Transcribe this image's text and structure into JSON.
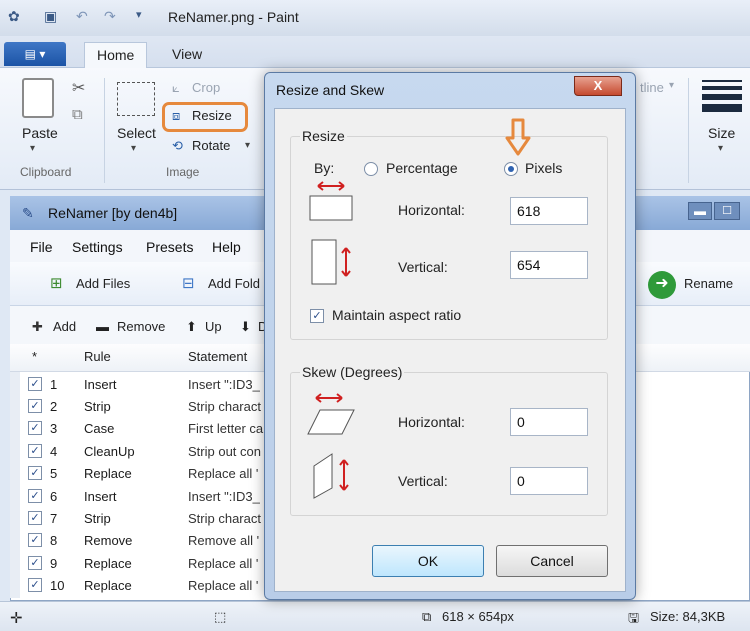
{
  "paint": {
    "title": "ReNamer.png - Paint",
    "tabs": [
      "Home",
      "View"
    ],
    "clipboard": {
      "paste": "Paste",
      "label": "Clipboard"
    },
    "image": {
      "select": "Select",
      "crop": "Crop",
      "resize": "Resize",
      "rotate": "Rotate",
      "label": "Image"
    },
    "outline": "tline",
    "size": "Size"
  },
  "renamer": {
    "title": "ReNamer  [by den4b]",
    "menu": [
      "File",
      "Settings",
      "Presets",
      "Help"
    ],
    "toolbar": {
      "add_files": "Add Files",
      "add_folders": "Add Fold",
      "rename": "Rename"
    },
    "rule_tools": {
      "add": "Add",
      "remove": "Remove",
      "up": "Up",
      "down": "D"
    },
    "columns": {
      "marker": "*",
      "rule": "Rule",
      "statement": "Statement"
    },
    "rows": [
      {
        "num": "1",
        "rule": "Insert",
        "statement": "Insert \":ID3_"
      },
      {
        "num": "2",
        "rule": "Strip",
        "statement": "Strip charact"
      },
      {
        "num": "3",
        "rule": "Case",
        "statement": "First letter ca"
      },
      {
        "num": "4",
        "rule": "CleanUp",
        "statement": "Strip out con"
      },
      {
        "num": "5",
        "rule": "Replace",
        "statement": "Replace all '"
      },
      {
        "num": "6",
        "rule": "Insert",
        "statement": "Insert \":ID3_"
      },
      {
        "num": "7",
        "rule": "Strip",
        "statement": "Strip charact"
      },
      {
        "num": "8",
        "rule": "Remove",
        "statement": "Remove all '"
      },
      {
        "num": "9",
        "rule": "Replace",
        "statement": "Replace all '"
      },
      {
        "num": "10",
        "rule": "Replace",
        "statement": "Replace all '"
      }
    ]
  },
  "dialog": {
    "title": "Resize and Skew",
    "close": "X",
    "resize_group": "Resize",
    "by_label": "By:",
    "percentage": "Percentage",
    "pixels": "Pixels",
    "horizontal_label": "Horizontal:",
    "horizontal_value": "618",
    "vertical_label": "Vertical:",
    "vertical_value": "654",
    "maintain": "Maintain aspect ratio",
    "skew_group": "Skew (Degrees)",
    "skew_horizontal_label": "Horizontal:",
    "skew_horizontal_value": "0",
    "skew_vertical_label": "Vertical:",
    "skew_vertical_value": "0",
    "ok": "OK",
    "cancel": "Cancel"
  },
  "status": {
    "dimensions": "618 × 654px",
    "size": "Size: 84,3KB"
  },
  "colors": {
    "highlight": "#e6893d",
    "accent": "#1c54a6"
  }
}
